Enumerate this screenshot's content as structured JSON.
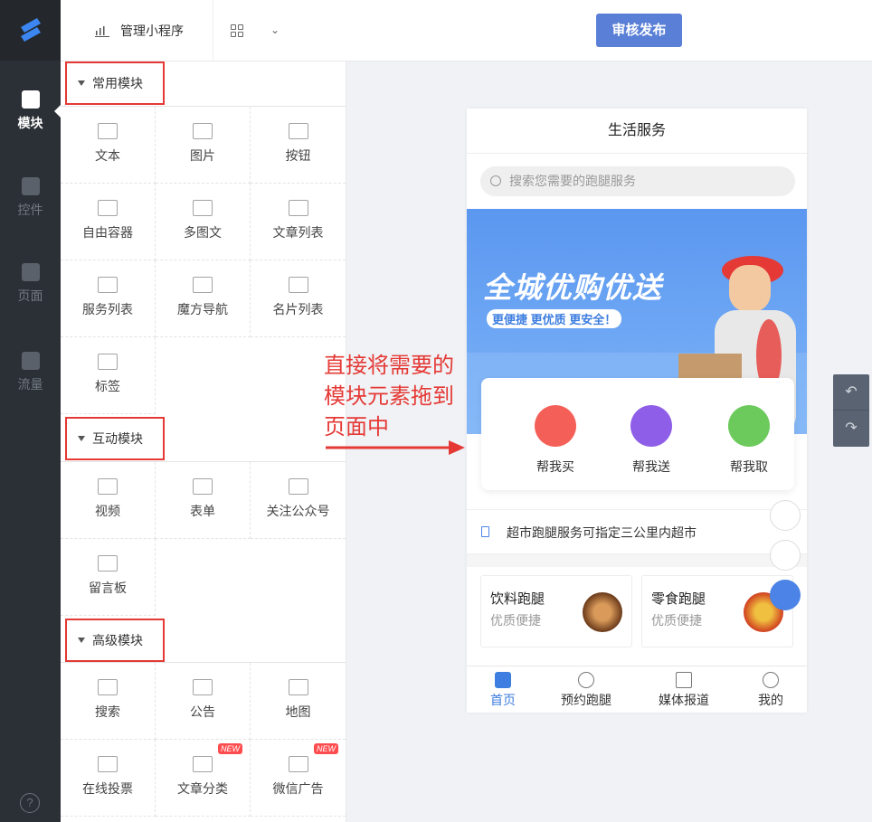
{
  "app": {
    "title": "管理小程序",
    "publish_label": "审核发布"
  },
  "nav": {
    "items": [
      {
        "label": "模块",
        "icon": "module-icon",
        "active": true
      },
      {
        "label": "控件",
        "icon": "widget-icon",
        "active": false
      },
      {
        "label": "页面",
        "icon": "page-icon",
        "active": false
      },
      {
        "label": "流量",
        "icon": "megaphone-icon",
        "active": false
      }
    ],
    "help": "?"
  },
  "panel": {
    "sections": [
      {
        "title": "常用模块",
        "items": [
          "文本",
          "图片",
          "按钮",
          "自由容器",
          "多图文",
          "文章列表",
          "服务列表",
          "魔方导航",
          "名片列表",
          "标签"
        ]
      },
      {
        "title": "互动模块",
        "items": [
          "视频",
          "表单",
          "关注公众号",
          "留言板"
        ]
      },
      {
        "title": "高级模块",
        "items": [
          "搜索",
          "公告",
          "地图",
          "在线投票",
          "文章分类",
          "微信广告"
        ]
      }
    ],
    "new_badge": "NEW"
  },
  "annotation": {
    "line1": "直接将需要的",
    "line2": "模块元素拖到",
    "line3": "页面中"
  },
  "preview": {
    "title": "生活服务",
    "search_placeholder": "搜索您需要的跑腿服务",
    "banner_title": "全城优购优送",
    "banner_sub": "更便捷 更优质 更安全！",
    "services": [
      "帮我买",
      "帮我送",
      "帮我取"
    ],
    "notice": "超市跑腿服务可指定三公里内超市",
    "tiles": [
      {
        "title": "饮料跑腿",
        "sub": "优质便捷"
      },
      {
        "title": "零食跑腿",
        "sub": "优质便捷"
      }
    ],
    "tabs": [
      "首页",
      "预约跑腿",
      "媒体报道",
      "我的"
    ]
  },
  "colors": {
    "accent": "#5a7fd6",
    "annotation": "#e53935",
    "nav_bg": "#2b3036"
  }
}
